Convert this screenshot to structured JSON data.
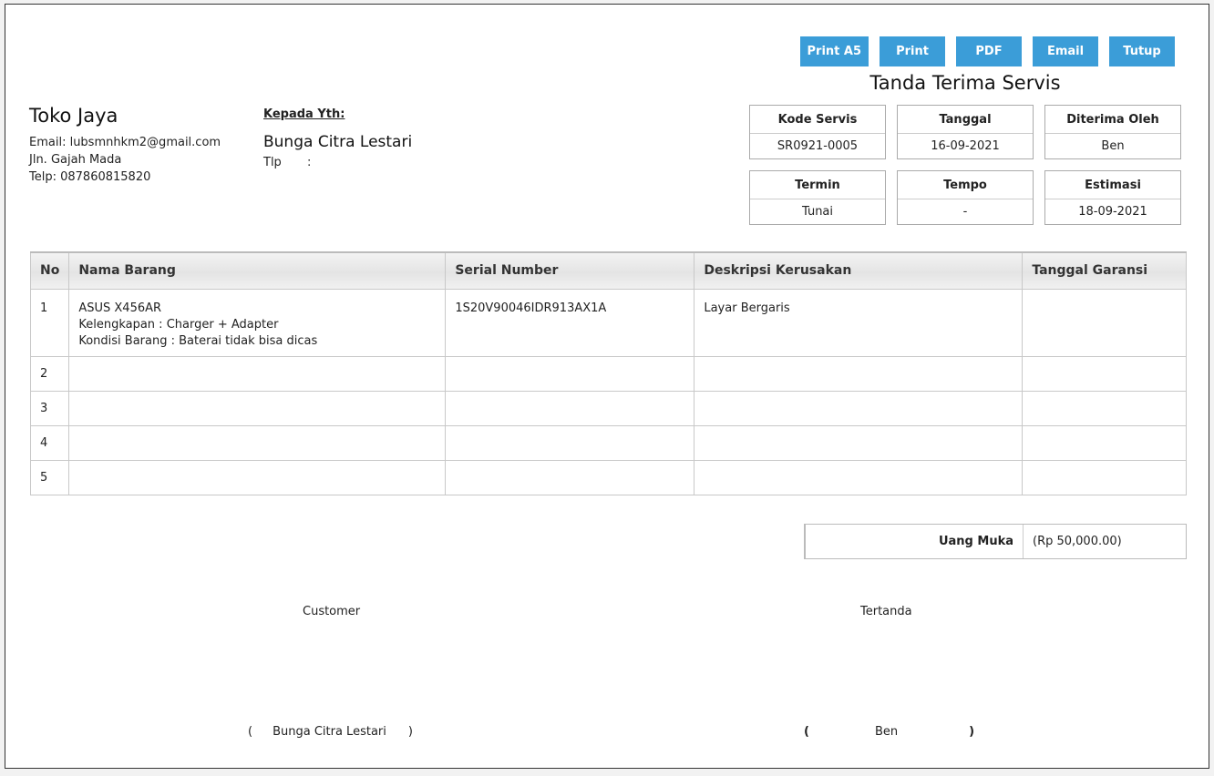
{
  "toolbar": {
    "print_a5": "Print A5",
    "print": "Print",
    "pdf": "PDF",
    "email": "Email",
    "close": "Tutup"
  },
  "document": {
    "title": "Tanda Terima Servis"
  },
  "shop": {
    "name": "Toko Jaya",
    "email": "Email: lubsmnhkm2@gmail.com",
    "address": "Jln. Gajah Mada",
    "phone": "Telp: 087860815820"
  },
  "recipient": {
    "label": "Kepada Yth:",
    "name": "Bunga Citra Lestari",
    "tlp_label": "Tlp",
    "tlp_sep": ":"
  },
  "info": {
    "kode_servis": {
      "label": "Kode Servis",
      "value": "SR0921-0005"
    },
    "tanggal": {
      "label": "Tanggal",
      "value": "16-09-2021"
    },
    "diterima_oleh": {
      "label": "Diterima Oleh",
      "value": "Ben"
    },
    "termin": {
      "label": "Termin",
      "value": "Tunai"
    },
    "tempo": {
      "label": "Tempo",
      "value": "-"
    },
    "estimasi": {
      "label": "Estimasi",
      "value": "18-09-2021"
    }
  },
  "table": {
    "headers": {
      "no": "No",
      "nama": "Nama Barang",
      "serial": "Serial Number",
      "desc": "Deskripsi Kerusakan",
      "garansi": "Tanggal Garansi"
    },
    "rows": [
      {
        "no": "1",
        "nama": "ASUS X456AR",
        "kelengkapan": "Kelengkapan : Charger + Adapter",
        "kondisi": "Kondisi Barang : Baterai tidak bisa dicas",
        "serial": "1S20V90046IDR913AX1A",
        "desc": "Layar Bergaris",
        "garansi": ""
      },
      {
        "no": "2"
      },
      {
        "no": "3"
      },
      {
        "no": "4"
      },
      {
        "no": "5"
      }
    ]
  },
  "down_payment": {
    "label": "Uang Muka",
    "value": "(Rp 50,000.00)"
  },
  "signatures": {
    "customer": {
      "title": "Customer",
      "open": "(",
      "name": "Bunga Citra Lestari",
      "close": ")"
    },
    "signed": {
      "title": "Tertanda",
      "open": "(",
      "name": "Ben",
      "close": ")"
    }
  }
}
